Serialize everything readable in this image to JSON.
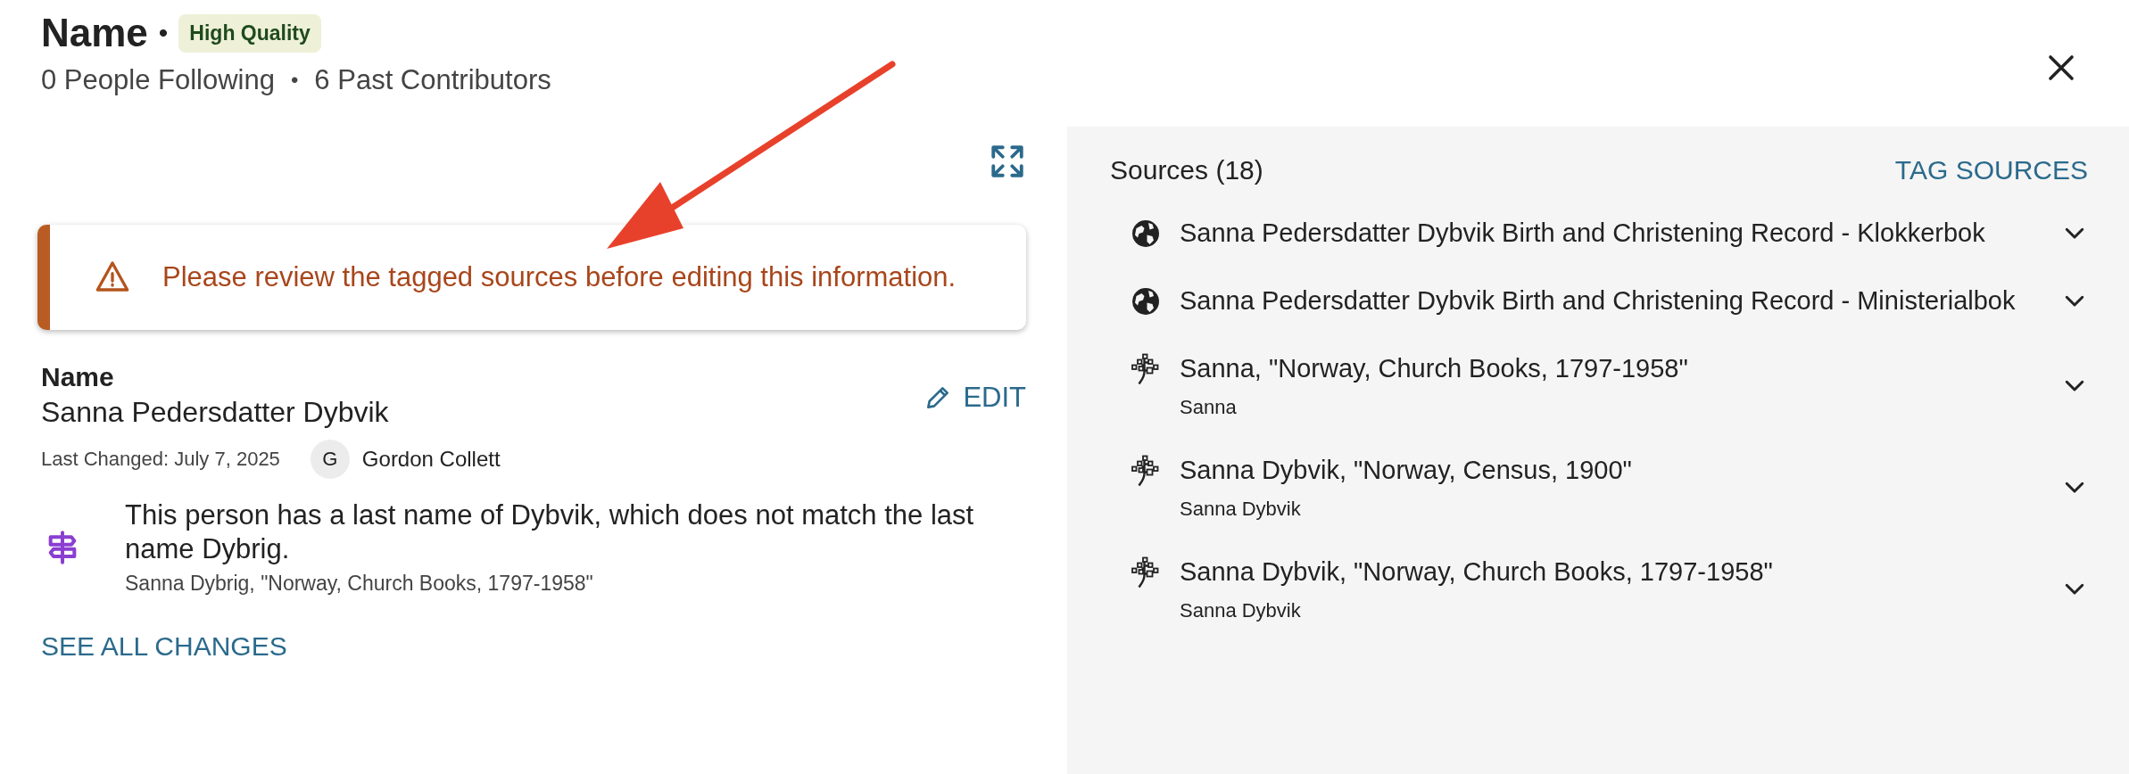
{
  "header": {
    "title": "Name",
    "separator": "•",
    "badge": "High Quality",
    "following": "0 People Following",
    "dot": "•",
    "contributors": "6 Past Contributors"
  },
  "alert": {
    "message": "Please review the tagged sources before editing this information."
  },
  "field": {
    "label": "Name",
    "value": "Sanna Pedersdatter Dybvik",
    "edit": "EDIT",
    "last_changed": "Last Changed: July 7, 2025",
    "avatar_initial": "G",
    "contributor": "Gordon Collett"
  },
  "notice": {
    "message": "This person has a last name of Dybvik, which does not match the last name Dybrig.",
    "source": "Sanna Dybrig, \"Norway, Church Books, 1797-1958\""
  },
  "see_all": "SEE ALL CHANGES",
  "sources": {
    "title": "Sources (18)",
    "action": "TAG SOURCES",
    "items": [
      {
        "kind": "globe",
        "title": "Sanna Pedersdatter Dybvik Birth and Christening Record - Klokkerbok"
      },
      {
        "kind": "globe",
        "title": "Sanna Pedersdatter Dybvik Birth and Christening Record - Ministerialbok"
      },
      {
        "kind": "tree",
        "title": "Sanna, \"Norway, Church Books, 1797-1958\"",
        "subtitle": "Sanna"
      },
      {
        "kind": "tree",
        "title": "Sanna Dybvik, \"Norway, Census, 1900\"",
        "subtitle": "Sanna Dybvik"
      },
      {
        "kind": "tree",
        "title": "Sanna Dybvik, \"Norway, Church Books, 1797-1958\"",
        "subtitle": "Sanna Dybvik"
      }
    ]
  }
}
